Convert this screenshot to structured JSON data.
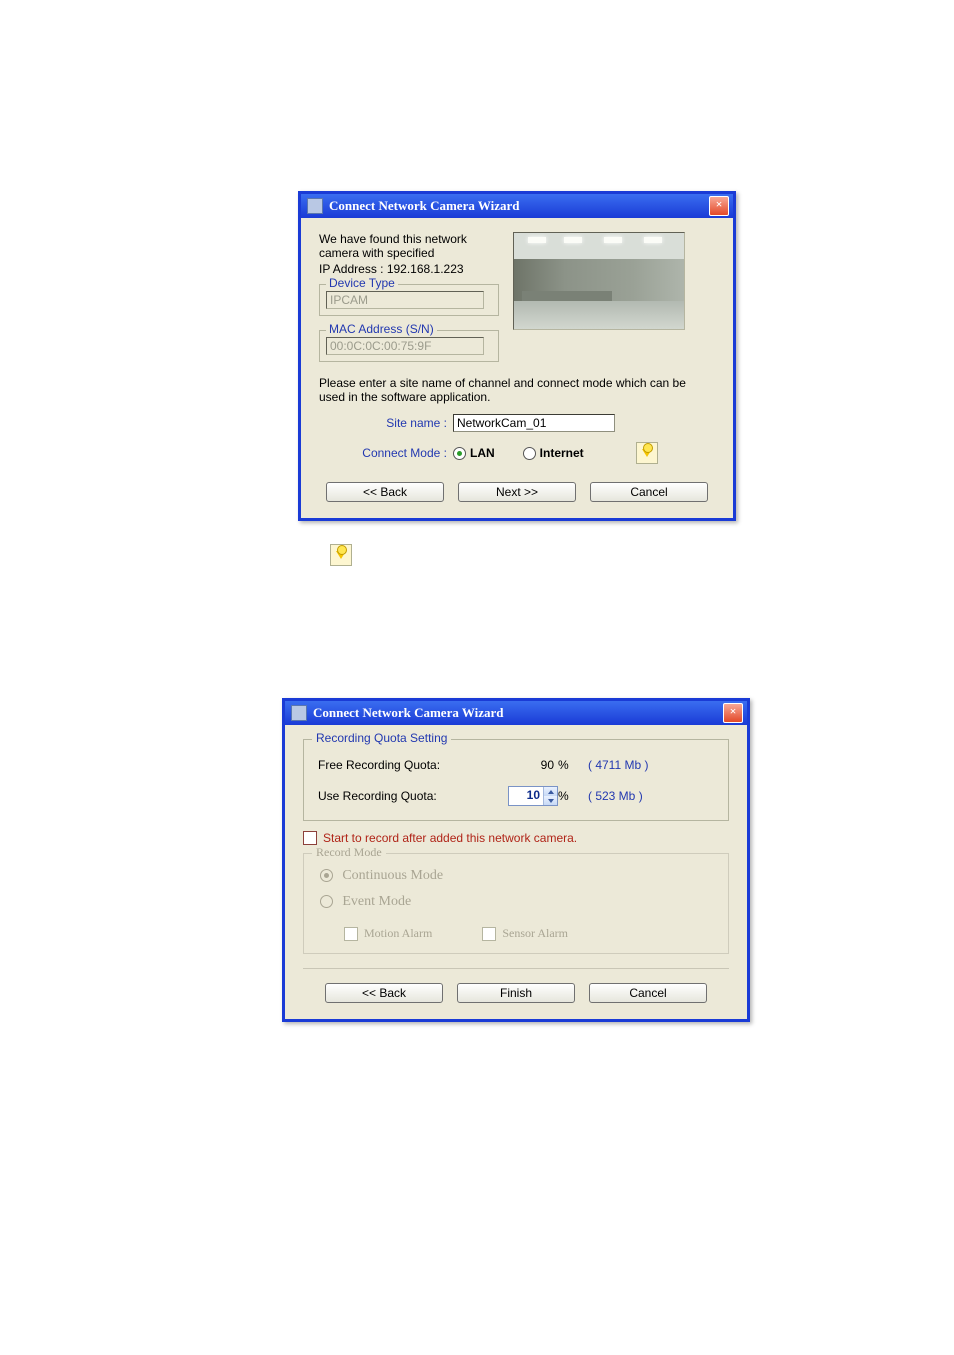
{
  "dialog1": {
    "title": "Connect Network Camera Wizard",
    "found_line1": "We have found this network camera with specified",
    "found_line2": "IP Address : 192.168.1.223",
    "device_type_legend": "Device Type",
    "device_type_value": "IPCAM",
    "mac_legend": "MAC Address (S/N)",
    "mac_value": "00:0C:0C:00:75:9F",
    "instruction": "Please enter a site name of channel and connect mode which can be used in the software application.",
    "site_name_label": "Site name :",
    "site_name_value": "NetworkCam_01",
    "connect_mode_label": "Connect Mode :",
    "lan_label": "LAN",
    "internet_label": "Internet",
    "back": "<< Back",
    "next": "Next >>",
    "cancel": "Cancel"
  },
  "dialog2": {
    "title": "Connect Network Camera Wizard",
    "quota_legend": "Recording Quota Setting",
    "free_label": "Free Recording Quota:",
    "free_value": "90",
    "free_mb": "( 4711 Mb )",
    "use_label": "Use Recording Quota:",
    "use_value": "10",
    "use_mb": "( 523 Mb )",
    "percent": "%",
    "start_record_label": "Start to record after added this network camera.",
    "record_mode_legend": "Record Mode",
    "continuous": "Continuous Mode",
    "event": "Event Mode",
    "motion": "Motion Alarm",
    "sensor": "Sensor Alarm",
    "back": "<< Back",
    "finish": "Finish",
    "cancel": "Cancel"
  }
}
